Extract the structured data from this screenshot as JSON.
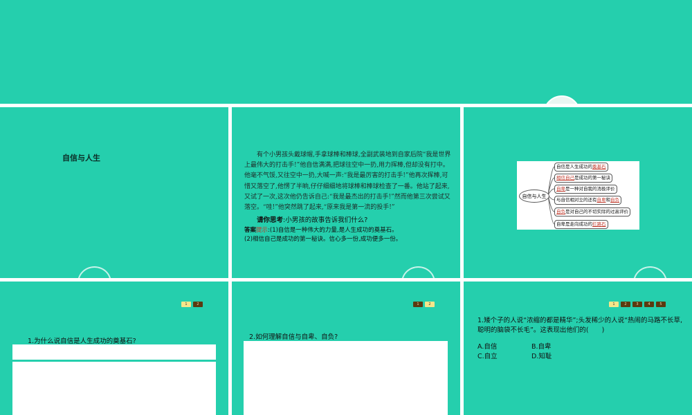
{
  "slide1": {
    "title": "自信与人生"
  },
  "slide2": {
    "story": "有个小男孩头戴球帽,手拿球棒和棒球,全副武装地到自家后院“我是世界上最伟大的打击手!”他自信满满,把球往空中一扔,用力挥棒,但却没有打中。他毫不气馁,又往空中一扔,大喊一声:“我是最厉害的打击手!”他再次挥棒,可惜又落空了,他愣了半晌,仔仔细细地将球棒和棒球检查了一番。他站了起来,又试了一次,这次他仍告诉自己:“我是最杰出的打击手!”然而他第三次尝试又落空。“哇!”他突然跳了起来,“原来我是第一流的投手!”",
    "question_label": "请你思考",
    "question_text": ":小男孩的故事告诉我们什么?",
    "answer_label": "答案",
    "hint_label": "提示",
    "answer_1": ":(1)自信是一种伟大的力量,是人生成功的奠基石。",
    "answer_2": "(2)相信自己是成功的第一秘诀。信心多一份,成功便多一份。"
  },
  "slide3": {
    "center": "自信与人生",
    "n1_a": "自信是人生成功的",
    "n1_b": "奠基石",
    "n2_a": "相信自己",
    "n2_b": "是成功的第一秘诀",
    "n3_a": "自卑",
    "n3_b": "是一种对自我的消极评价",
    "n4_a": "与自信相对立的还有",
    "n4_b": "自卑",
    "n4_c": "和",
    "n4_d": "自负",
    "n5_a": "自负",
    "n5_b": "是对自己的不切实际的过高评价",
    "n6_a": "自卑是走向成功的",
    "n6_b": "拦路石"
  },
  "slide4": {
    "pages": [
      "1",
      "2"
    ],
    "question": "1.为什么说自信是人生成功的奠基石?"
  },
  "slide5": {
    "pages": [
      "1",
      "2"
    ],
    "question": "2.如何理解自信与自卑、自负?"
  },
  "slide6": {
    "pages": [
      "1",
      "2",
      "3",
      "4",
      "5"
    ],
    "question": "1.矮个子的人说“浓缩的都是精华”;头发稀少的人说“热闹的马路不长草,聪明的脑袋不长毛”。这表现出他们的(　　)",
    "options": [
      "A.自信",
      "B.自卑",
      "C.自立",
      "D.知耻"
    ]
  }
}
